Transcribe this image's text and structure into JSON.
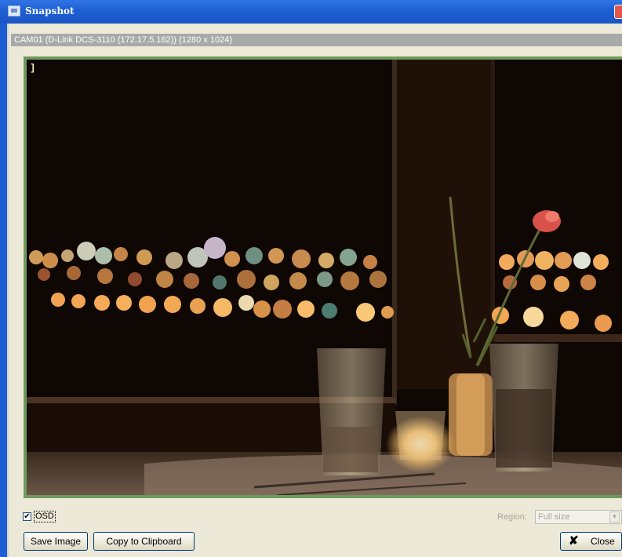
{
  "window": {
    "title": "Snapshot",
    "caption": "CAM01 (D-Link DCS-3110 (172.17.5.162)) (1280 x 1024)"
  },
  "viewer": {
    "osd_text": "]"
  },
  "controls": {
    "osd_checkbox_mark": "✔",
    "osd_label": "OSD",
    "region_label": "Region:",
    "region_value": "Full size",
    "dropdown_arrow": "▼"
  },
  "buttons": {
    "save": "Save Image",
    "copy": "Copy to Clipboard",
    "close_icon": "✘",
    "close": "Close"
  },
  "icons": {
    "app": "snapshot-window-icon",
    "window_close": "window-close-icon"
  }
}
